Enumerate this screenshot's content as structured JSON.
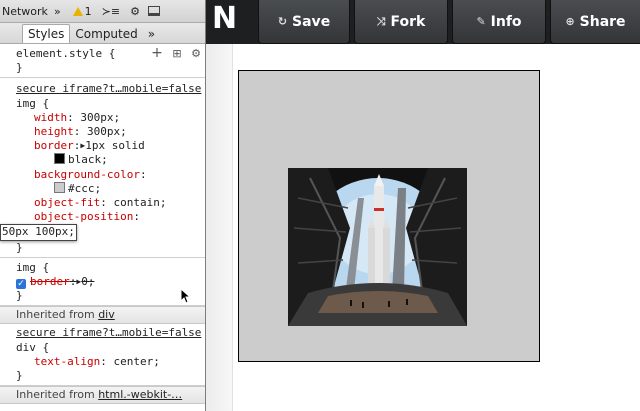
{
  "devtools": {
    "topbar": {
      "network_label": "Network",
      "overflow_label": "»",
      "warning_count": "1",
      "console_icon": "console-icon",
      "settings_icon": "gear-icon",
      "dock_icon": "dock-icon"
    },
    "tabs": {
      "styles": "Styles",
      "computed": "Computed",
      "more": "»"
    },
    "element_style": {
      "selector": "element.style {",
      "close": "}",
      "add_icon": "+",
      "toggle_icon": "⊞",
      "gear_icon": "⚙"
    },
    "rule1": {
      "source": "secure iframe?t…mobile=false",
      "selector": "img {",
      "close": "}",
      "props": {
        "width_name": "width",
        "width_value": "300px;",
        "height_name": "height",
        "height_value": "300px;",
        "border_name": "border",
        "border_value_1": "1px solid",
        "border_value_2": "black;",
        "bg_name": "background-color",
        "bg_value": "#ccc;",
        "fit_name": "object-fit",
        "fit_value": "contain;",
        "pos_name": "object-position",
        "pos_value": "50px 100px;"
      },
      "swatches": {
        "black": "#000000",
        "ccc": "#cccccc"
      }
    },
    "rule2": {
      "selector": "img {",
      "close": "}",
      "prop_name": "border",
      "prop_value": "0;"
    },
    "inherited1": {
      "label": "Inherited from",
      "link": "div"
    },
    "rule3": {
      "source": "secure iframe?t…mobile=false",
      "selector": "div {",
      "close": "}",
      "prop_name": "text-align",
      "prop_value": "center;"
    },
    "inherited2": {
      "label": "Inherited from",
      "link": "html.-webkit-…"
    }
  },
  "header": {
    "logo": "N",
    "buttons": [
      {
        "icon": "save-icon",
        "glyph": "↻",
        "label": "Save"
      },
      {
        "icon": "fork-icon",
        "glyph": "⤨",
        "label": "Fork"
      },
      {
        "icon": "info-icon",
        "glyph": "✎",
        "label": "Info"
      },
      {
        "icon": "share-icon",
        "glyph": "⊕",
        "label": "Share"
      }
    ]
  },
  "preview": {
    "box_bg": "#cccccc",
    "box_border": "#000000",
    "image_subject": "rocket-launch-photo"
  }
}
